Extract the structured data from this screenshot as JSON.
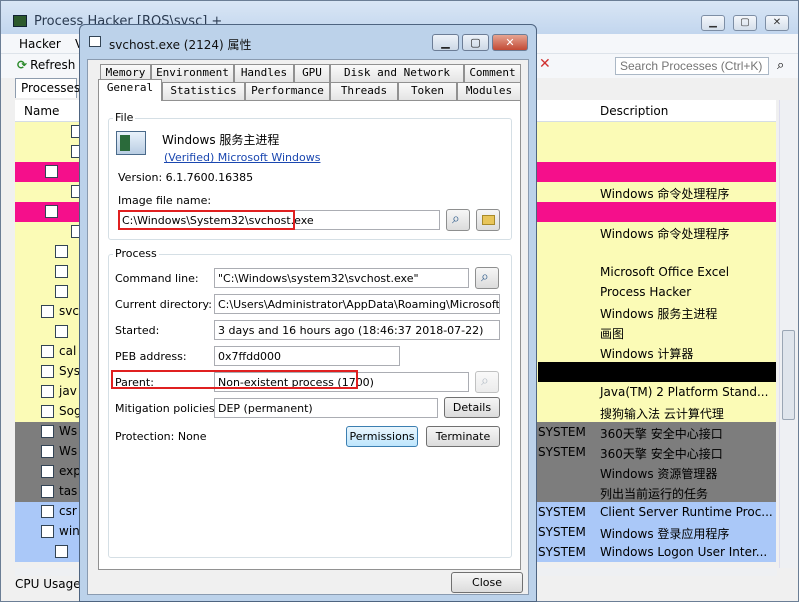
{
  "main": {
    "title": "Process Hacker [ROS\\sysc] +",
    "menu": [
      "Hacker",
      "V"
    ],
    "refresh_label": "Refresh",
    "search_placeholder": "Search Processes (Ctrl+K)",
    "tab_label": "Processes",
    "columns": {
      "name": "Name",
      "description": "Description"
    },
    "status_label": "CPU Usage",
    "rows": [
      {
        "name": "",
        "user": "",
        "description": "",
        "color": "#fbfbb6",
        "indent": 56
      },
      {
        "name": "",
        "user": "",
        "description": "",
        "color": "#fbfbb6",
        "indent": 56
      },
      {
        "name": "",
        "user": "",
        "description": "",
        "color": "#f50f8b",
        "indent": 30
      },
      {
        "name": "",
        "user": "",
        "description": "Windows 命令处理程序",
        "color": "#fbfbb6",
        "indent": 56
      },
      {
        "name": "",
        "user": "",
        "description": "",
        "color": "#f50f8b",
        "indent": 30
      },
      {
        "name": "",
        "user": "",
        "description": "Windows 命令处理程序",
        "color": "#fbfbb6",
        "indent": 56
      },
      {
        "name": "",
        "user": "",
        "description": "",
        "color": "#fbfbb6",
        "indent": 40
      },
      {
        "name": "",
        "user": "",
        "description": "Microsoft Office Excel",
        "color": "#fbfbb6",
        "indent": 40
      },
      {
        "name": "",
        "user": "",
        "description": "Process Hacker",
        "color": "#fbfbb6",
        "indent": 40
      },
      {
        "name": "svc",
        "user": "",
        "description": "Windows 服务主进程",
        "color": "#fbfbb6",
        "indent": 26
      },
      {
        "name": "",
        "user": "",
        "description": "画图",
        "color": "#fbfbb6",
        "indent": 40
      },
      {
        "name": "cal",
        "user": "",
        "description": "Windows 计算器",
        "color": "#fbfbb6",
        "indent": 26
      },
      {
        "name": "Sys",
        "user": "",
        "description": "",
        "color": "#fbfbb6",
        "indent": 26,
        "selected": true
      },
      {
        "name": "jav",
        "user": "",
        "description": "Java(TM) 2 Platform Stand...",
        "color": "#fbfbb6",
        "indent": 26
      },
      {
        "name": "Sog",
        "user": "",
        "description": "搜狗输入法 云计算代理",
        "color": "#fbfbb6",
        "indent": 26
      },
      {
        "name": "Ws",
        "user": "SYSTEM",
        "description": "360天擎 安全中心接口",
        "color": "#7d7d7d",
        "indent": 26
      },
      {
        "name": "Ws",
        "user": "SYSTEM",
        "description": "360天擎 安全中心接口",
        "color": "#7d7d7d",
        "indent": 26
      },
      {
        "name": "exp",
        "user": "",
        "description": "Windows 资源管理器",
        "color": "#7d7d7d",
        "indent": 26
      },
      {
        "name": "tas",
        "user": "",
        "description": "列出当前运行的任务",
        "color": "#7d7d7d",
        "indent": 26
      },
      {
        "name": "csr",
        "user": "SYSTEM",
        "description": "Client Server Runtime Proc...",
        "color": "#aac8f8",
        "indent": 26
      },
      {
        "name": "win",
        "user": "SYSTEM",
        "description": "Windows 登录应用程序",
        "color": "#aac8f8",
        "indent": 26
      },
      {
        "name": "",
        "user": "SYSTEM",
        "description": "Windows Logon User Inter...",
        "color": "#aac8f8",
        "indent": 40
      }
    ]
  },
  "dialog": {
    "title": "svchost.exe (2124) 属性",
    "tabs_row1": [
      "Memory",
      "Environment",
      "Handles",
      "GPU",
      "Disk and Network",
      "Comment"
    ],
    "tabs_row2": [
      "General",
      "Statistics",
      "Performance",
      "Threads",
      "Token",
      "Modules"
    ],
    "file": {
      "group_label": "File",
      "description": "Windows 服务主进程",
      "company": "(Verified) Microsoft Windows",
      "version": "Version: 6.1.7600.16385",
      "image_label": "Image file name:",
      "image_path": "C:\\Windows\\System32\\svchost.exe"
    },
    "process": {
      "group_label": "Process",
      "command_line_label": "Command line:",
      "command_line": "\"C:\\Windows\\system32\\svchost.exe\"",
      "current_dir_label": "Current directory:",
      "current_dir": "C:\\Users\\Administrator\\AppData\\Roaming\\Microsoft\\Windows",
      "started_label": "Started:",
      "started": "3 days and 16 hours ago (18:46:37 2018-07-22)",
      "peb_label": "PEB address:",
      "peb": "0x7ffdd000",
      "parent_label": "Parent:",
      "parent": "Non-existent process (1700)",
      "mitigation_label": "Mitigation policies:",
      "mitigation": "DEP (permanent)",
      "details_button": "Details",
      "protection": "Protection: None",
      "permissions_button": "Permissions",
      "terminate_button": "Terminate"
    },
    "close_button": "Close"
  }
}
